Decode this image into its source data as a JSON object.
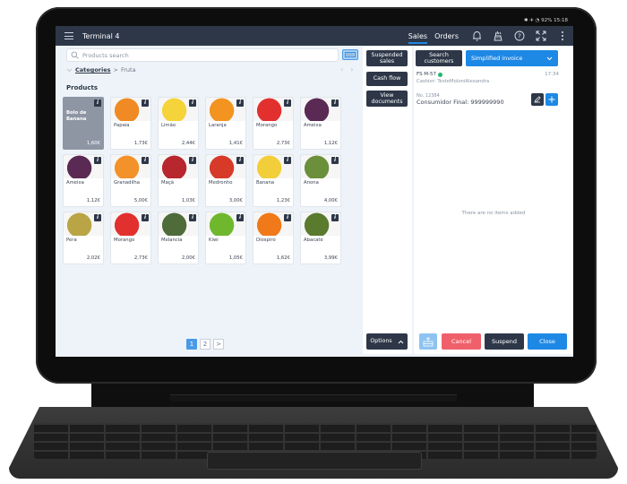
{
  "status_bar": {
    "indicators": "✱ ✈ ◔ 92%",
    "time": "15:18"
  },
  "app_bar": {
    "title": "Terminal 4",
    "tabs": [
      {
        "label": "Sales",
        "active": true
      },
      {
        "label": "Orders",
        "active": false
      }
    ],
    "icons": [
      "bell-icon",
      "cash-register-icon",
      "help-icon",
      "fullscreen-icon",
      "more-vert-icon"
    ]
  },
  "left": {
    "search_placeholder": "Products search",
    "breadcrumb": {
      "root": "Categories",
      "separator": ">",
      "current": "Fruta"
    },
    "arrows": {
      "prev": "‹",
      "next": "›"
    },
    "products_heading": "Products",
    "products": [
      {
        "name": "Bolo de Banana",
        "price": "1,60€",
        "image": null
      },
      {
        "name": "Papaia",
        "price": "1,73€",
        "image": "papaya",
        "color": "#f08a24"
      },
      {
        "name": "Limão",
        "price": "2,44€",
        "image": "lemon",
        "color": "#f5d33a"
      },
      {
        "name": "Laranja",
        "price": "1,41€",
        "image": "orange",
        "color": "#f39421"
      },
      {
        "name": "Morango",
        "price": "2,73€",
        "image": "strawberry",
        "color": "#e2302f"
      },
      {
        "name": "Ameixa",
        "price": "1,12€",
        "image": "plum",
        "color": "#5a2a55"
      },
      {
        "name": "Ameixa",
        "price": "1,12€",
        "image": "plum",
        "color": "#5a2a55"
      },
      {
        "name": "Granadilha",
        "price": "5,00€",
        "image": "granadilla",
        "color": "#f3922a"
      },
      {
        "name": "Maçã",
        "price": "1,03€",
        "image": "apple",
        "color": "#b8262e"
      },
      {
        "name": "Medronho",
        "price": "3,00€",
        "image": "arbutus",
        "color": "#d83a2a"
      },
      {
        "name": "Banana",
        "price": "1,23€",
        "image": "banana",
        "color": "#f2cf3a"
      },
      {
        "name": "Anona",
        "price": "4,00€",
        "image": "custard-apple",
        "color": "#6b8f3a"
      },
      {
        "name": "Pera",
        "price": "2,02€",
        "image": "pear",
        "color": "#b9a545"
      },
      {
        "name": "Morango",
        "price": "2,73€",
        "image": "strawberry",
        "color": "#e2302f"
      },
      {
        "name": "Melancia",
        "price": "2,00€",
        "image": "watermelon",
        "color": "#4f6b3a"
      },
      {
        "name": "Kiwi",
        "price": "1,05€",
        "image": "kiwi",
        "color": "#6fb82e"
      },
      {
        "name": "Diospiro",
        "price": "1,62€",
        "image": "persimmon",
        "color": "#f07a1a"
      },
      {
        "name": "Abacate",
        "price": "3,99€",
        "image": "avocado",
        "color": "#5a7a2e"
      }
    ],
    "pagination": {
      "pages": [
        "1",
        "2"
      ],
      "current": "1",
      "next": ">"
    }
  },
  "middle": {
    "suspended_sales": "Suspended sales",
    "cash_flow": "Cash flow",
    "view_documents": "View documents",
    "options": "Options"
  },
  "right": {
    "search_customers": "Search customers",
    "document_type": "Simplified invoice",
    "document_number": "FS M-57",
    "time": "17:34",
    "cashier": "Cashier: TesteMoloniAlexandra",
    "customer_no": "No. 12384",
    "customer": "Consumidor Final: 999999990",
    "empty_message": "There are no items added",
    "buttons": {
      "cancel": "Cancel",
      "suspend": "Suspend",
      "close": "Close"
    }
  },
  "colors": {
    "primary": "#1e88e5",
    "dark": "#2d3748",
    "danger": "#f0606a",
    "success": "#22b573"
  }
}
